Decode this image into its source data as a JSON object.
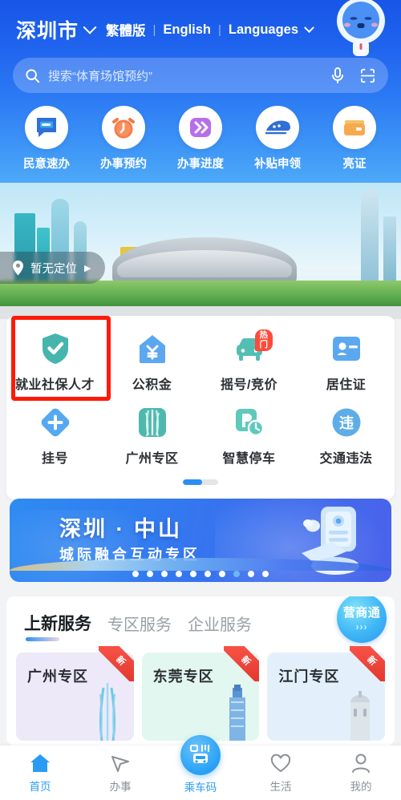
{
  "header": {
    "city": "深圳市",
    "city_chevron": "chevron-down-icon",
    "lang_traditional": "繁體版",
    "lang_english": "English",
    "lang_more": "Languages",
    "separator": "|",
    "mascot": "robot-mascot-avatar"
  },
  "search": {
    "placeholder": "搜索“体育场馆预约”",
    "icon": "search-icon",
    "voice_icon": "microphone-icon",
    "scan_icon": "scan-code-icon"
  },
  "quick_actions": [
    {
      "label": "民意速办",
      "icon": "speech-bubble-icon"
    },
    {
      "label": "办事预约",
      "icon": "alarm-clock-icon"
    },
    {
      "label": "办事进度",
      "icon": "double-chevron-icon"
    },
    {
      "label": "补贴申领",
      "icon": "high-speed-train-icon"
    },
    {
      "label": "亮证",
      "icon": "wallet-card-icon"
    }
  ],
  "location": {
    "text": "暂无定位",
    "pin_icon": "map-pin-icon",
    "arrow": "▶"
  },
  "service_grid": {
    "items": [
      {
        "label": "就业社保人才",
        "icon": "shield-check-icon",
        "badge": "",
        "highlighted": true
      },
      {
        "label": "公积金",
        "icon": "house-yuan-icon",
        "badge": ""
      },
      {
        "label": "摇号/竞价",
        "icon": "car-icon",
        "badge": "热门"
      },
      {
        "label": "居住证",
        "icon": "id-card-icon",
        "badge": ""
      },
      {
        "label": "挂号",
        "icon": "medical-cross-icon",
        "badge": ""
      },
      {
        "label": "广州专区",
        "icon": "guangzhou-tower-icon",
        "badge": ""
      },
      {
        "label": "智慧停车",
        "icon": "parking-clock-icon",
        "badge": ""
      },
      {
        "label": "交通违法",
        "icon": "traffic-violation-icon",
        "badge": ""
      }
    ],
    "page_indicator": {
      "pages": 2,
      "current": 1
    }
  },
  "promo_banner": {
    "title": "深圳 · 中山",
    "subtitle": "城际融合互动专区",
    "illustration": "robot-document-icon",
    "dots_total": 10,
    "dots_active": 8
  },
  "service_panel": {
    "tabs": [
      {
        "label": "上新服务",
        "active": true
      },
      {
        "label": "专区服务",
        "active": false
      },
      {
        "label": "企业服务",
        "active": false
      }
    ],
    "stamp": {
      "title": "营商通",
      "arrows": "›››"
    },
    "cards": [
      {
        "title": "广州专区",
        "corner": "新",
        "landmark": "canton-tower-icon",
        "bg": "#ede9f8"
      },
      {
        "title": "东莞专区",
        "corner": "新",
        "landmark": "dongguan-tower-icon",
        "bg": "#e2f7f0"
      },
      {
        "title": "江门专区",
        "corner": "新",
        "landmark": "jiangmen-tower-icon",
        "bg": "#e3f0fb"
      }
    ]
  },
  "bottom_nav": [
    {
      "label": "首页",
      "icon": "home-icon",
      "active": true
    },
    {
      "label": "办事",
      "icon": "paper-plane-icon",
      "active": false
    },
    {
      "label": "乘车码",
      "icon": "bus-qr-icon",
      "active": true,
      "center": true
    },
    {
      "label": "生活",
      "icon": "heart-icon",
      "active": false
    },
    {
      "label": "我的",
      "icon": "user-icon",
      "active": false
    }
  ],
  "colors": {
    "brand_blue": "#2a9bf5",
    "header_top": "#1756e8",
    "highlight_red": "#ff1a08",
    "badge_red": "#ff4b3a"
  }
}
